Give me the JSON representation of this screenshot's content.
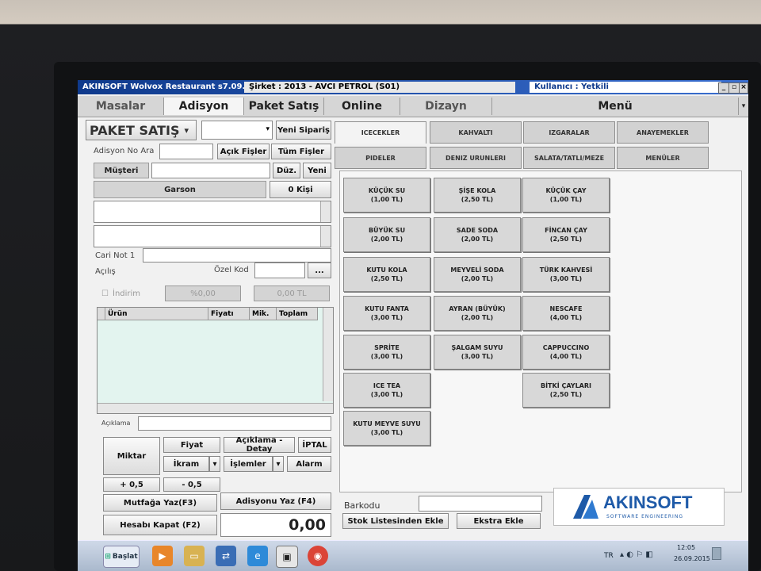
{
  "window": {
    "title": "AKINSOFT Wolvox Restaurant s7.09.0",
    "company": "Şirket : 2013 - AVCI PETROL (S01)",
    "user": "Kullanıcı : Yetkili"
  },
  "menu": [
    "Masalar",
    "Adisyon",
    "Paket Satış",
    "Online",
    "Dizayn",
    "Menü"
  ],
  "left": {
    "mode": "PAKET SATIŞ",
    "mode_arrow": "▾",
    "new_order": "Yeni Sipariş",
    "adisyon_no_label": "Adisyon No Ara",
    "open_receipts": "Açık Fişler",
    "all_receipts": "Tüm Fişler",
    "customer": "Müşteri",
    "edit": "Düz.",
    "new": "Yeni",
    "waiter": "Garson",
    "persons": "0 Kişi",
    "cari_note": "Cari Not 1",
    "opening": "Açılış",
    "special_code": "Özel Kod",
    "dots": "...",
    "discount": "İndirim",
    "discount_pct": "%0,00",
    "discount_amt": "0,00 TL",
    "grid_headers": [
      "Ürün",
      "Fiyatı",
      "Mik.",
      "Toplam"
    ],
    "description": "Açıklama",
    "amount": "Miktar",
    "price": "Fiyat",
    "desc_detail": "Açıklama - Detay",
    "cancel": "İPTAL",
    "treat": "İkram",
    "operations": "İşlemler",
    "alarm": "Alarm",
    "plus_half": "+ 0,5",
    "minus_half": "- 0,5",
    "kitchen_print": "Mutfağa Yaz(F3)",
    "print_receipt": "Adisyonu Yaz (F4)",
    "close_bill": "Hesabı Kapat (F2)",
    "total": "0,00"
  },
  "categories": [
    [
      "ICECEKLER",
      "KAHVALTI",
      "IZGARALAR",
      "ANAYEMEKLER"
    ],
    [
      "PIDELER",
      "DENIZ URUNLERI",
      "SALATA/TATLI/MEZE",
      "MENÜLER"
    ]
  ],
  "products": [
    [
      {
        "name": "KÜÇÜK SU",
        "price": "(1,00 TL)"
      },
      {
        "name": "BÜYÜK SU",
        "price": "(2,00 TL)"
      },
      {
        "name": "KUTU KOLA",
        "price": "(2,50 TL)"
      },
      {
        "name": "KUTU FANTA",
        "price": "(3,00 TL)"
      },
      {
        "name": "SPRİTE",
        "price": "(3,00 TL)"
      },
      {
        "name": "ICE TEA",
        "price": "(3,00 TL)"
      },
      {
        "name": "KUTU MEYVE SUYU",
        "price": "(3,00 TL)"
      }
    ],
    [
      {
        "name": "ŞİŞE KOLA",
        "price": "(2,50 TL)"
      },
      {
        "name": "SADE SODA",
        "price": "(2,00 TL)"
      },
      {
        "name": "MEYVELİ SODA",
        "price": "(2,00 TL)"
      },
      {
        "name": "AYRAN (BÜYÜK)",
        "price": "(2,00 TL)"
      },
      {
        "name": "ŞALGAM SUYU",
        "price": "(3,00 TL)"
      }
    ],
    [
      {
        "name": "KÜÇÜK ÇAY",
        "price": "(1,00 TL)"
      },
      {
        "name": "FİNCAN ÇAY",
        "price": "(2,50 TL)"
      },
      {
        "name": "TÜRK KAHVESİ",
        "price": "(3,00 TL)"
      },
      {
        "name": "NESCAFE",
        "price": "(4,00 TL)"
      },
      {
        "name": "CAPPUCCINO",
        "price": "(4,00 TL)"
      },
      {
        "name": "BİTKİ ÇAYLARI",
        "price": "(2,50 TL)"
      }
    ]
  ],
  "bottom": {
    "barcode": "Barkodu",
    "stock_add": "Stok Listesinden Ekle",
    "extra_add": "Ekstra Ekle",
    "logo": "AKINSOFT",
    "logo_sub": "SOFTWARE ENGINEERING"
  },
  "taskbar": {
    "start": "Başlat",
    "lang": "TR",
    "time": "12:05",
    "date": "26.09.2015"
  }
}
